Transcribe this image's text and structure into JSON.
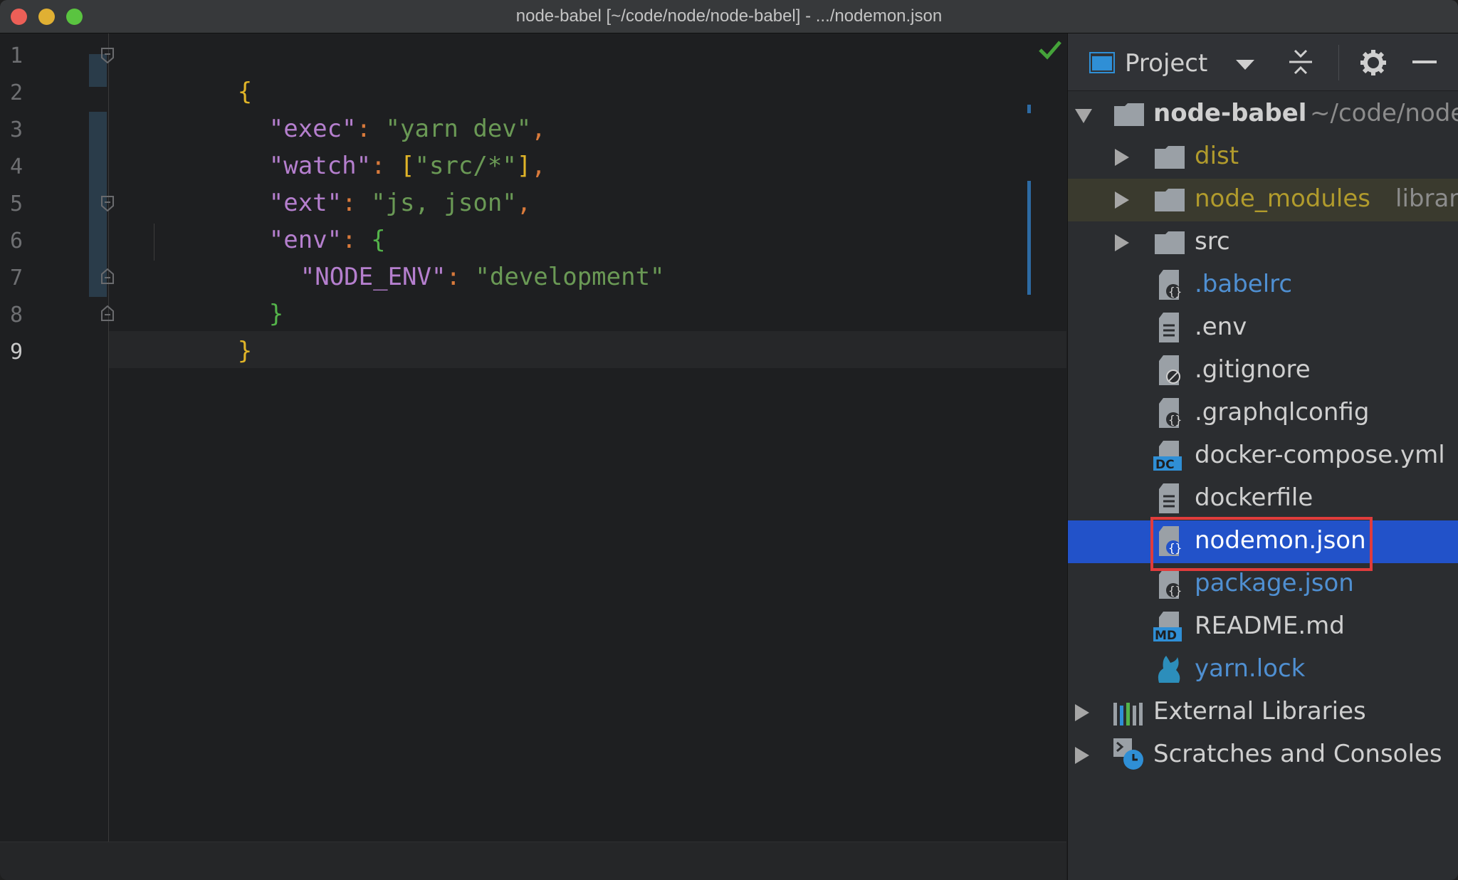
{
  "window": {
    "title": "node-babel [~/code/node/node-babel] - .../nodemon.json"
  },
  "editor": {
    "line_numbers": [
      "1",
      "2",
      "3",
      "4",
      "5",
      "6",
      "7",
      "8",
      "9"
    ],
    "active_line": "9",
    "lines": {
      "l1_brace": "{",
      "l2_key": "\"exec\"",
      "l2_colon": ": ",
      "l2_value": "\"yarn dev\"",
      "l2_comma": ",",
      "l3_key": "\"watch\"",
      "l3_colon": ": ",
      "l3_open": "[",
      "l3_value": "\"src/*\"",
      "l3_close": "]",
      "l3_comma": ",",
      "l4_key": "\"ext\"",
      "l4_colon": ": ",
      "l4_value": "\"js, json\"",
      "l4_comma": ",",
      "l5_key": "\"env\"",
      "l5_colon": ": ",
      "l5_brace": "{",
      "l6_key": "\"NODE_ENV\"",
      "l6_colon": ": ",
      "l6_value": "\"development\"",
      "l7_brace": "}",
      "l8_brace": "}"
    }
  },
  "project_panel": {
    "view_label": "Project",
    "root": {
      "name": "node-babel",
      "path": "~/code/node"
    },
    "items": [
      {
        "label": "dist",
        "kind": "folder"
      },
      {
        "label": "node_modules",
        "suffix": "library",
        "kind": "folder"
      },
      {
        "label": "src",
        "kind": "folder"
      },
      {
        "label": ".babelrc",
        "kind": "json-file"
      },
      {
        "label": ".env",
        "kind": "text-file"
      },
      {
        "label": ".gitignore",
        "kind": "ignore-file"
      },
      {
        "label": ".graphqlconfig",
        "kind": "json-file"
      },
      {
        "label": "docker-compose.yml",
        "kind": "docker-compose-file",
        "badge": "DC"
      },
      {
        "label": "dockerfile",
        "kind": "text-file"
      },
      {
        "label": "nodemon.json",
        "kind": "json-file",
        "selected": true
      },
      {
        "label": "package.json",
        "kind": "json-file"
      },
      {
        "label": "README.md",
        "kind": "markdown-file",
        "badge": "MD"
      },
      {
        "label": "yarn.lock",
        "kind": "yarn-file"
      }
    ],
    "external_libraries": "External Libraries",
    "scratches": "Scratches and Consoles"
  },
  "colors": {
    "selection": "#2252c9",
    "highlight_box": "#e03c3c",
    "json_key": "#b57fce",
    "json_string": "#6a9955",
    "folder_gold": "#b19b2c",
    "vcs_blue": "#4f8fd1"
  }
}
